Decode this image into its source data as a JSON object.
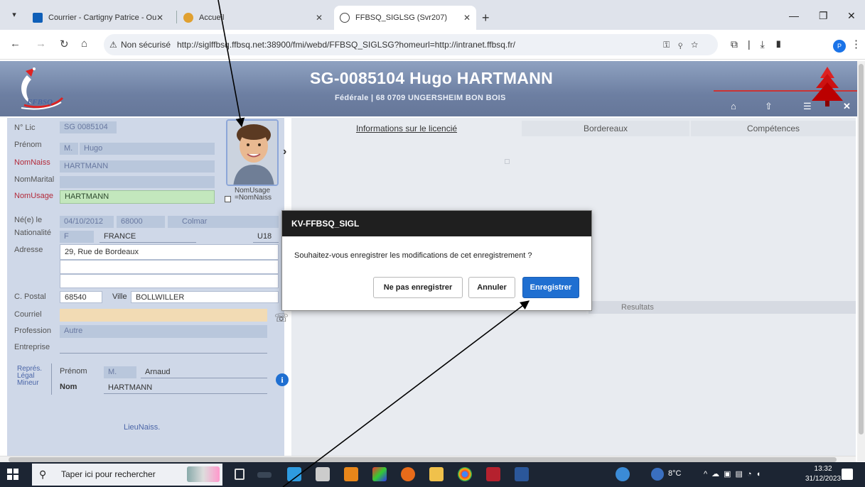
{
  "browser": {
    "tabs": [
      {
        "title": "Courrier - Cartigny Patrice - Ou",
        "icon": "outlook-icon"
      },
      {
        "title": "Accueil",
        "icon": "intranet-icon"
      },
      {
        "title": "FFBSQ_SIGLSG (Svr207)",
        "icon": "globe-icon"
      }
    ],
    "security_label": "Non sécurisé",
    "url": "http://siglffbsq.ffbsq.net:38900/fmi/webd/FFBSQ_SIGLSG?homeurl=http://intranet.ffbsq.fr/",
    "profile_initial": "P"
  },
  "header": {
    "title": "SG-0085104 Hugo HARTMANN",
    "subtitle": "Fédérale | 68 0709 UNGERSHEIM BON BOIS",
    "logo_text": "FFBSQ"
  },
  "form": {
    "nlic_label": "N° Lic",
    "nlic_value": "SG 0085104",
    "prenom_label": "Prénom",
    "civilite": "M.",
    "prenom_value": "Hugo",
    "nomnaiss_label": "NomNaiss",
    "nomnaiss_value": "HARTMANN",
    "nommarital_label": "NomMarital",
    "nomusage_label": "NomUsage",
    "nomusage_value": "HARTMANN",
    "nomusage_check_line1": "NomUsage",
    "nomusage_check_line2": "=NomNaiss",
    "ne_label": "Né(e) le",
    "birth_date": "04/10/2012",
    "birth_cp": "68000",
    "birth_city": "Colmar",
    "nationalite_label": "Nationalité",
    "nat_code": "F",
    "nat_value": "FRANCE",
    "category": "U18",
    "adresse_label": "Adresse",
    "adresse_value": "29, Rue de Bordeaux",
    "cp_label": "C. Postal",
    "cp_value": "68540",
    "ville_label": "Ville",
    "ville_value": "BOLLWILLER",
    "courriel_label": "Courriel",
    "profession_label": "Profession",
    "profession_value": "Autre",
    "entreprise_label": "Entreprise",
    "rep_line1": "Représ.",
    "rep_line2": "Légal",
    "rep_line3": "Mineur",
    "rep_prenom_label": "Prénom",
    "rep_civilite": "M.",
    "rep_prenom_value": "Arnaud",
    "rep_nom_label": "Nom",
    "rep_nom_value": "HARTMANN",
    "lieunaiss_link": "LieuNaiss."
  },
  "right_tabs": [
    "Informations sur le licencié",
    "Bordereaux",
    "Compétences"
  ],
  "results_tab": "Resultats",
  "modal": {
    "title": "KV-FFBSQ_SIGL",
    "message": "Souhaitez-vous enregistrer les modifications de cet enregistrement ?",
    "btn_no_save": "Ne pas enregistrer",
    "btn_cancel": "Annuler",
    "btn_save": "Enregistrer"
  },
  "taskbar": {
    "search_placeholder": "Taper ici pour rechercher",
    "weather": "8°C",
    "time": "13:32",
    "date": "31/12/2023"
  },
  "colors": {
    "header_bg": "#7486a8",
    "panel_bg": "#cfd8e8",
    "primary_button": "#1f6fd1",
    "label_red": "#b32a3a",
    "taskbar": "#1c2533"
  }
}
